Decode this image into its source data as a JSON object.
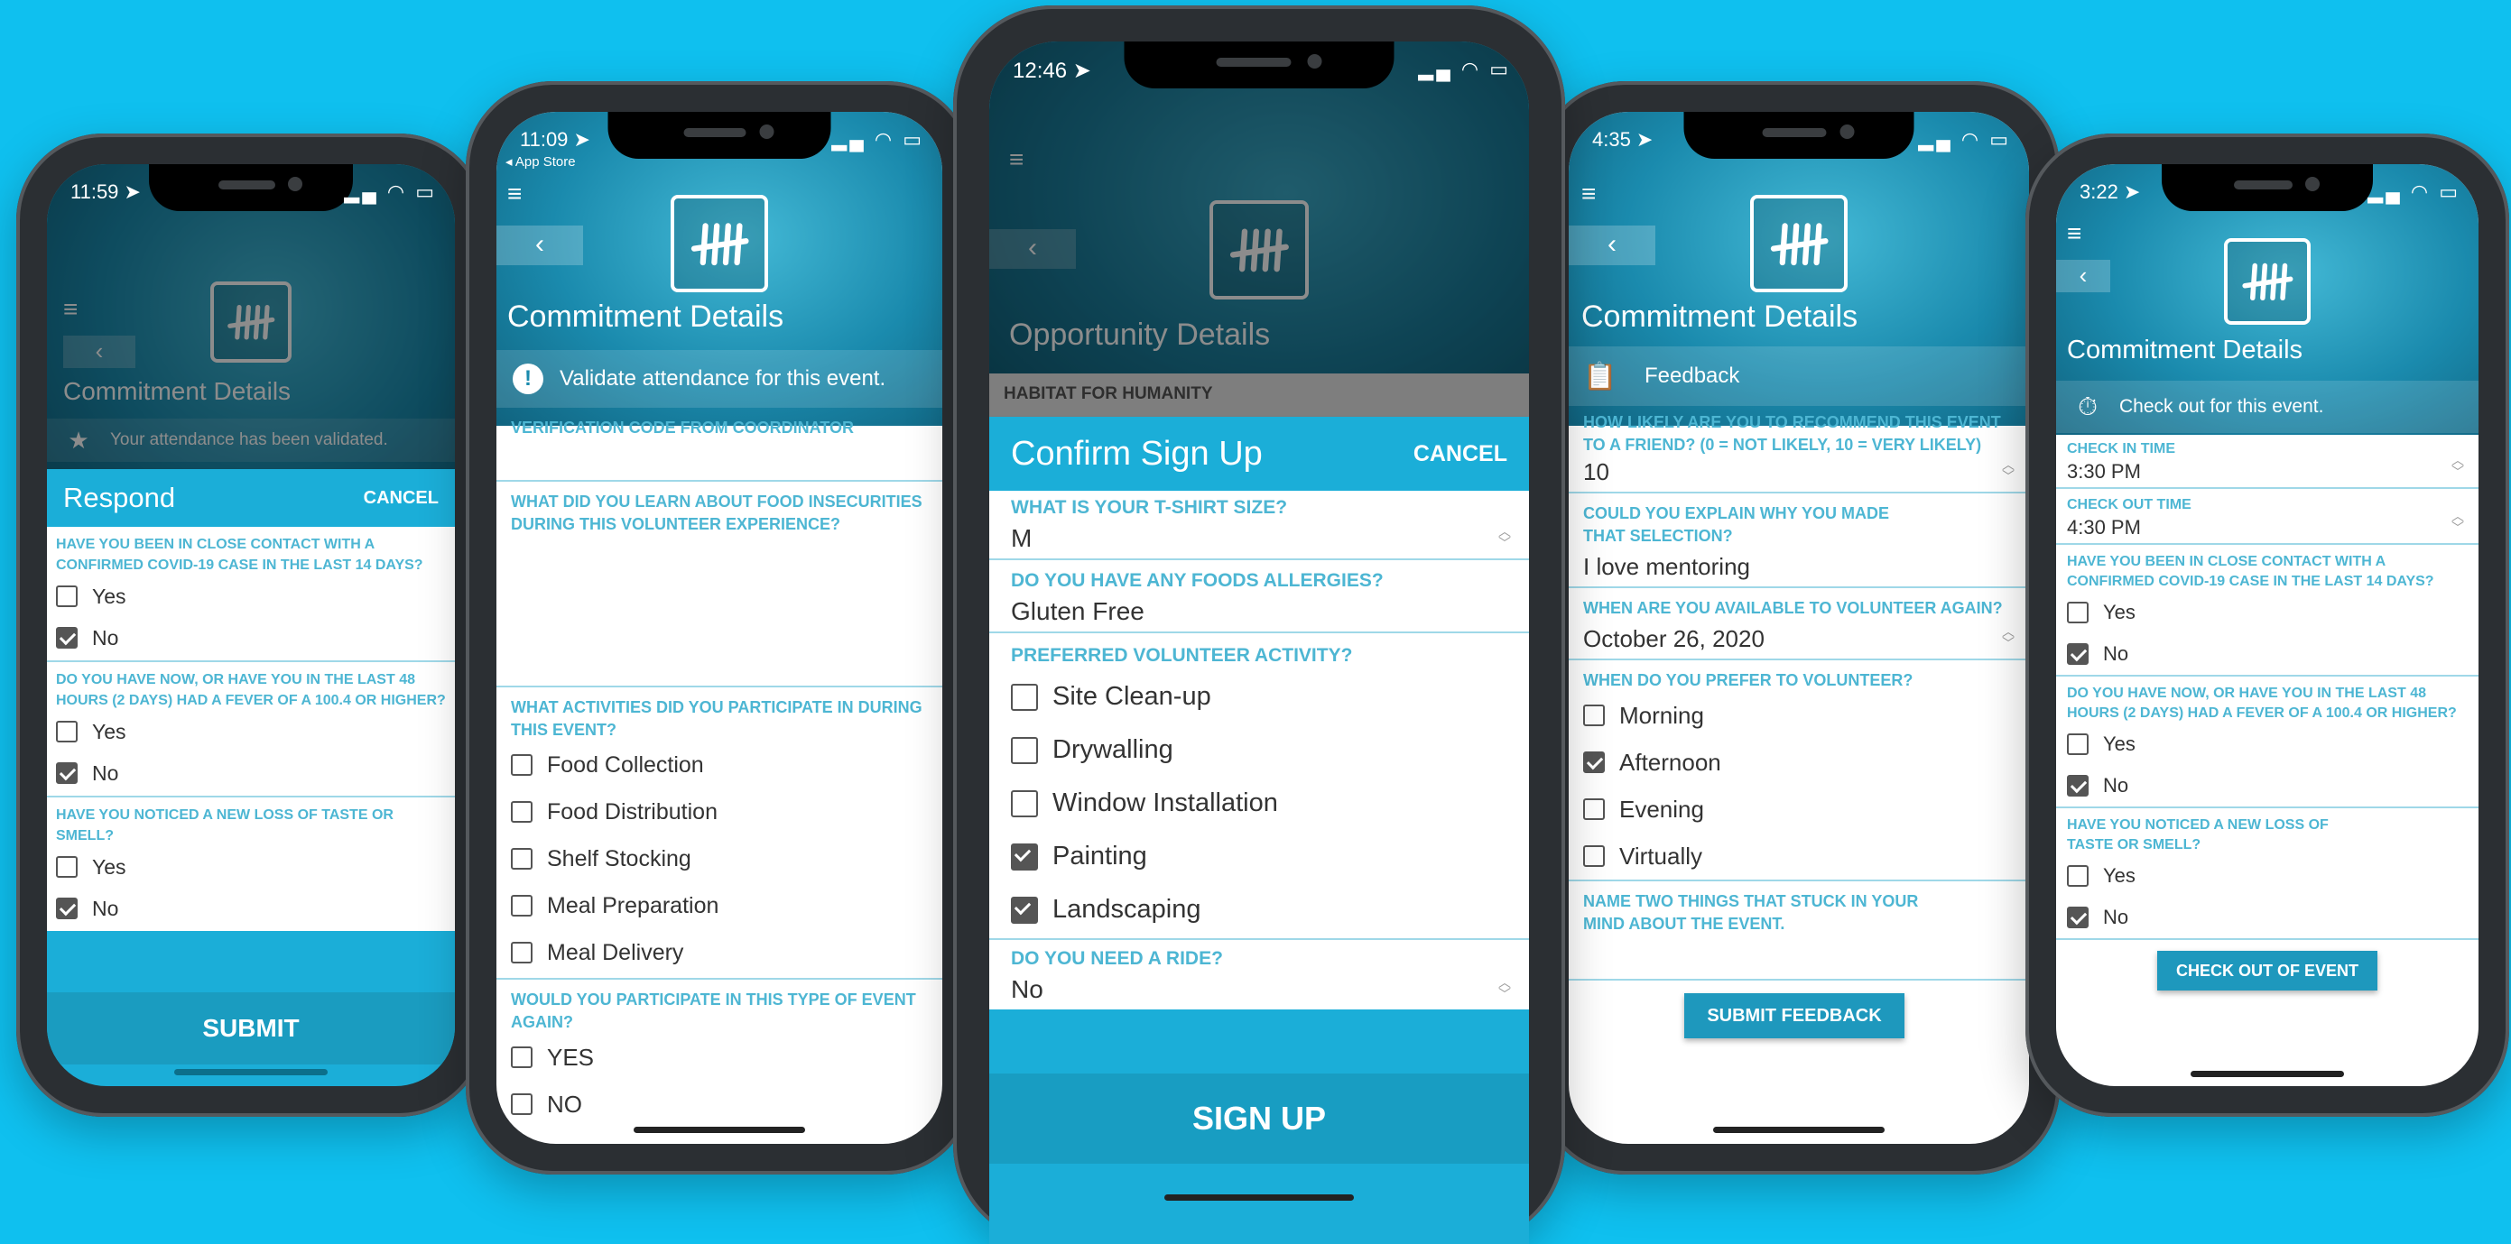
{
  "logo_icon": "tally-marks-logo",
  "phone1": {
    "time": "11:59 ➤",
    "title": "Commitment Details",
    "banner": "Your attendance has been validated.",
    "sheet_title": "Respond",
    "cancel": "CANCEL",
    "q1": "HAVE YOU BEEN IN CLOSE CONTACT WITH A CONFIRMED COVID-19 CASE IN THE LAST 14 DAYS?",
    "q2": "DO YOU HAVE NOW, OR HAVE YOU IN THE LAST 48 HOURS (2 DAYS) HAD A FEVER OF A 100.4 OR HIGHER?",
    "q3": "HAVE YOU NOTICED A NEW LOSS OF TASTE OR SMELL?",
    "yes": "Yes",
    "no": "No",
    "submit": "SUBMIT"
  },
  "phone2": {
    "time": "11:09 ➤",
    "store": "◂ App Store",
    "title": "Commitment Details",
    "banner": "Validate attendance for this event.",
    "q1": "VERIFICATION CODE FROM COORDINATOR",
    "q2": "WHAT DID YOU LEARN ABOUT FOOD INSECURITIES DURING THIS VOLUNTEER EXPERIENCE?",
    "q3": "WHAT ACTIVITIES DID YOU PARTICIPATE IN DURING THIS EVENT?",
    "activities": [
      "Food Collection",
      "Food Distribution",
      "Shelf Stocking",
      "Meal Preparation",
      "Meal Delivery"
    ],
    "q4": "WOULD YOU PARTICIPATE IN THIS TYPE OF EVENT AGAIN?",
    "opt_yes": "YES",
    "opt_no": "NO"
  },
  "phone3": {
    "time": "12:46 ➤",
    "title": "Opportunity Details",
    "org": "HABITAT FOR HUMANITY",
    "sheet_title": "Confirm Sign Up",
    "cancel": "CANCEL",
    "q1": "WHAT IS YOUR T-SHIRT SIZE?",
    "v1": "M",
    "q2": "DO YOU HAVE ANY FOODS ALLERGIES?",
    "v2": "Gluten Free",
    "q3": "PREFERRED VOLUNTEER ACTIVITY?",
    "activities": [
      "Site Clean-up",
      "Drywalling",
      "Window Installation",
      "Painting",
      "Landscaping"
    ],
    "activities_checked": [
      false,
      false,
      false,
      true,
      true
    ],
    "q4": "DO YOU NEED A RIDE?",
    "v4": "No",
    "signup": "SIGN UP"
  },
  "phone4": {
    "time": "4:35 ➤",
    "title": "Commitment Details",
    "section": "Feedback",
    "q1": "HOW LIKELY ARE YOU TO RECOMMEND THIS EVENT TO A FRIEND? (0 = NOT LIKELY, 10 = VERY LIKELY)",
    "v1": "10",
    "q2": "COULD YOU EXPLAIN WHY YOU MADE THAT SELECTION?",
    "v2": "I love mentoring",
    "q3": "WHEN ARE YOU AVAILABLE TO VOLUNTEER AGAIN?",
    "v3": "October 26, 2020",
    "q4": "WHEN DO YOU PREFER TO VOLUNTEER?",
    "times": [
      "Morning",
      "Afternoon",
      "Evening",
      "Virtually"
    ],
    "times_checked": [
      false,
      true,
      false,
      false
    ],
    "q5": "NAME TWO THINGS THAT STUCK IN YOUR MIND ABOUT THE EVENT.",
    "submit": "SUBMIT FEEDBACK"
  },
  "phone5": {
    "time": "3:22 ➤",
    "title": "Commitment Details",
    "banner": "Check out for this event.",
    "q_in": "CHECK IN TIME",
    "v_in": "3:30 PM",
    "q_out": "CHECK OUT TIME",
    "v_out": "4:30 PM",
    "q1": "HAVE YOU BEEN IN CLOSE CONTACT WITH A CONFIRMED COVID-19 CASE IN THE LAST 14 DAYS?",
    "q2": "DO YOU HAVE NOW, OR HAVE YOU IN THE LAST 48 HOURS (2 DAYS) HAD A FEVER OF A 100.4 OR HIGHER?",
    "q3": "HAVE YOU NOTICED A NEW LOSS OF TASTE OR SMELL?",
    "yes": "Yes",
    "no": "No",
    "checkout": "CHECK OUT OF EVENT"
  }
}
